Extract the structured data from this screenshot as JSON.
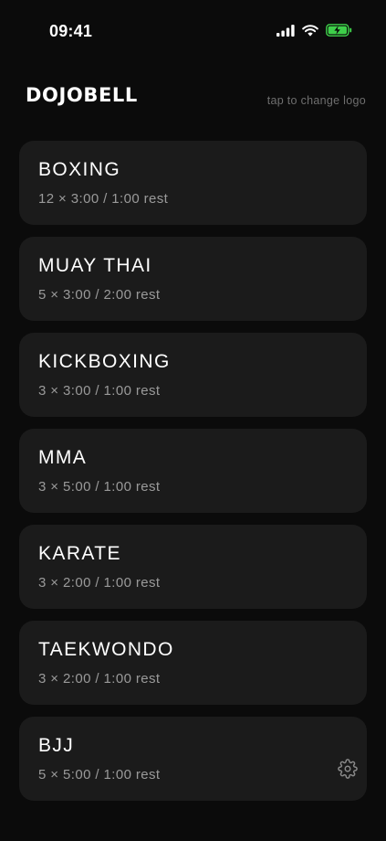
{
  "status_bar": {
    "time": "09:41",
    "icons": [
      "signal-bars-icon",
      "wifi-icon",
      "battery-charging-icon"
    ],
    "battery_color": "#3ecf4a"
  },
  "header": {
    "logo": "DOJOBELL",
    "hint": "tap to change logo"
  },
  "presets": [
    {
      "name": "BOXING",
      "summary": "12 × 3:00 / 1:00 rest"
    },
    {
      "name": "MUAY THAI",
      "summary": "5 × 3:00 / 2:00 rest"
    },
    {
      "name": "KICKBOXING",
      "summary": "3 × 3:00 / 1:00 rest"
    },
    {
      "name": "MMA",
      "summary": "3 × 5:00 / 1:00 rest"
    },
    {
      "name": "KARATE",
      "summary": "3 × 2:00 / 1:00 rest"
    },
    {
      "name": "TAEKWONDO",
      "summary": "3 × 2:00 / 1:00 rest"
    },
    {
      "name": "BJJ",
      "summary": "5 × 5:00 / 1:00 rest"
    }
  ],
  "settings_icon": "gear-icon",
  "colors": {
    "background": "#0b0b0b",
    "card": "#1b1b1b",
    "subtext": "#9a9a9a",
    "hint": "#6f6f6f"
  }
}
